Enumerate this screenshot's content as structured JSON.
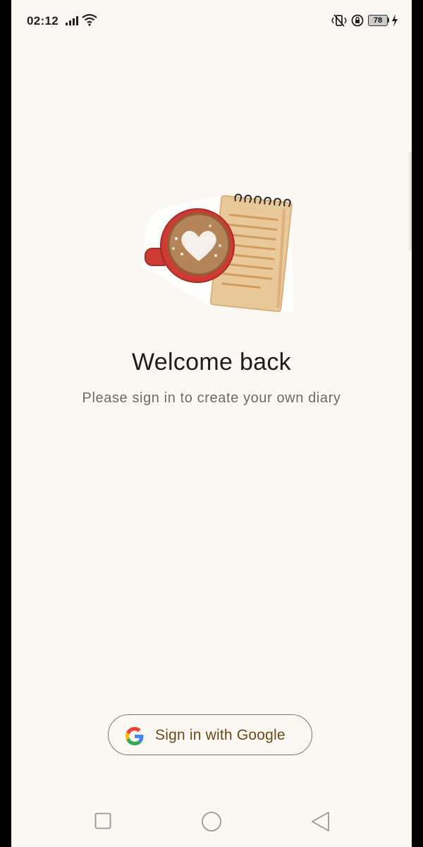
{
  "status_bar": {
    "time": "02:12",
    "battery_level": "78",
    "icons": [
      "signal-icon",
      "wifi-icon",
      "vibrate-icon",
      "rotation-lock-icon",
      "battery-icon",
      "charging-icon"
    ]
  },
  "main": {
    "illustration": "coffee-cup-notebook-illustration",
    "title": "Welcome back",
    "subtitle": "Please sign in to create your own diary"
  },
  "sign_in": {
    "label": "Sign in with Google",
    "icon": "google-icon"
  },
  "nav_bar": {
    "icons": [
      "recents-icon",
      "home-icon",
      "back-icon"
    ]
  },
  "colors": {
    "background": "#fbf8f4",
    "button_text": "#6b4a14",
    "cup_red": "#cc3b34"
  }
}
